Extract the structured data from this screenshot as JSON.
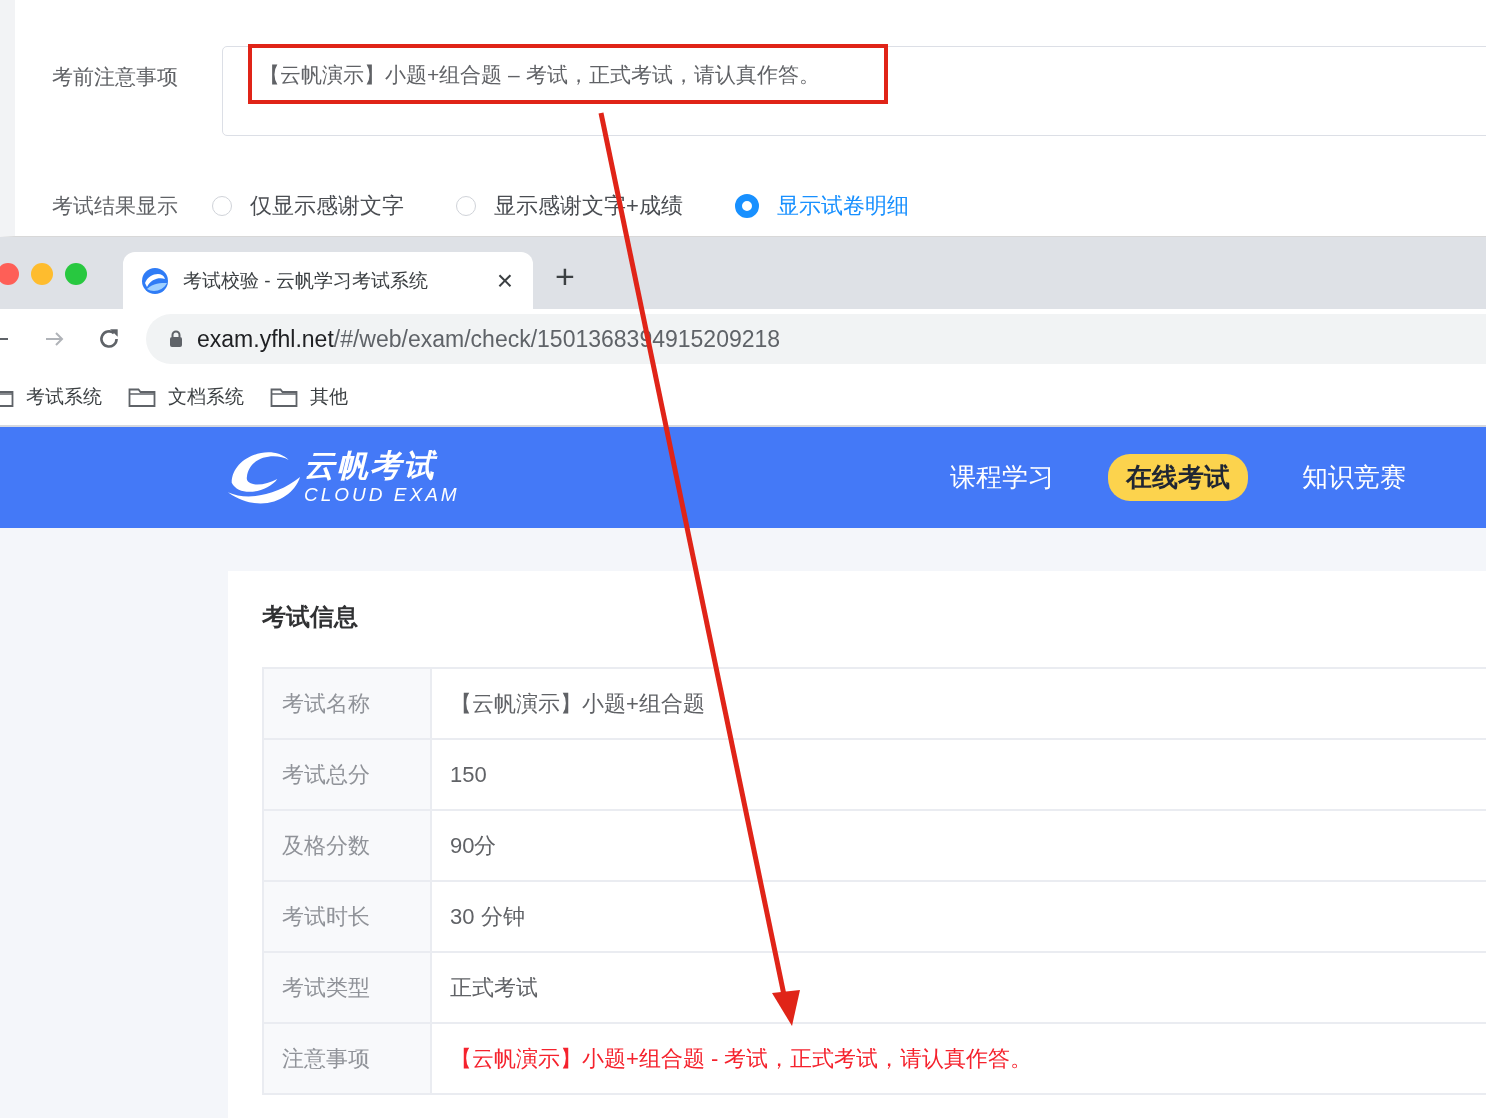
{
  "form": {
    "notice_label": "考前注意事项",
    "notice_value": "【云帆演示】小题+组合题 – 考试，正式考试，请认真作答。",
    "result_label": "考试结果显示",
    "result_options": [
      {
        "label": "仅显示感谢文字",
        "selected": false
      },
      {
        "label": "显示感谢文字+成绩",
        "selected": false
      },
      {
        "label": "显示试卷明细",
        "selected": true
      }
    ]
  },
  "browser": {
    "tab_title": "考试校验 - 云帆学习考试系统",
    "tab_close": "×",
    "new_tab": "+",
    "url_host": "exam.yfhl.net",
    "url_path": "/#/web/exam/check/1501368394915209218",
    "bookmarks": [
      {
        "label": "考试系统"
      },
      {
        "label": "文档系统"
      },
      {
        "label": "其他"
      }
    ]
  },
  "site": {
    "logo_cn": "云帆考试",
    "logo_en": "CLOUD EXAM",
    "nav": [
      {
        "label": "课程学习",
        "selected": false
      },
      {
        "label": "在线考试",
        "selected": true
      },
      {
        "label": "知识竞赛",
        "selected": false
      }
    ]
  },
  "exam_info": {
    "title": "考试信息",
    "rows": [
      {
        "label": "考试名称",
        "value": "【云帆演示】小题+组合题",
        "kind": "plain"
      },
      {
        "label": "考试总分",
        "value": "150",
        "kind": "plain"
      },
      {
        "label": "及格分数",
        "value": "90分",
        "kind": "plain"
      },
      {
        "label": "考试时长",
        "value": "30 分钟",
        "kind": "plain"
      },
      {
        "label": "考试类型",
        "value": "正式考试",
        "kind": "plain"
      },
      {
        "label": "注意事项",
        "value": "【云帆演示】小题+组合题 - 考试，正式考试，请认真作答。",
        "kind": "notice"
      }
    ]
  }
}
